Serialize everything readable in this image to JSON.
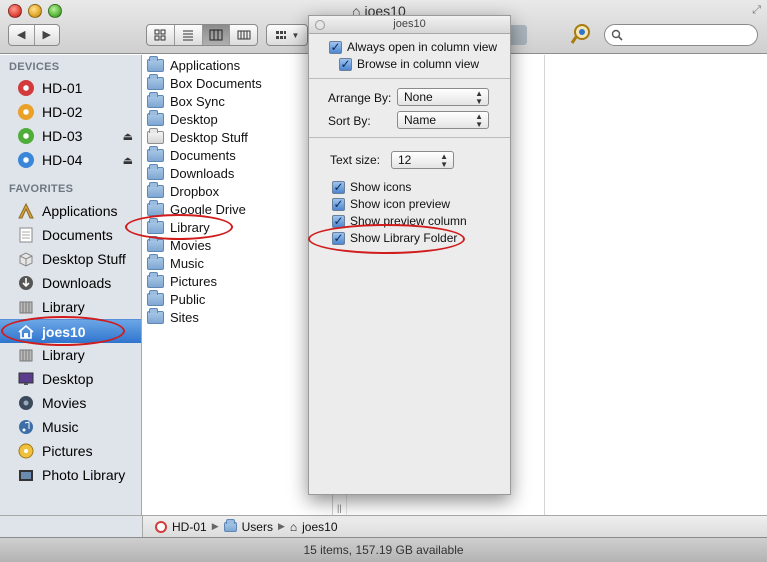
{
  "window": {
    "title": "joes10"
  },
  "toolbar": {
    "back_label": "◀",
    "forward_label": "▶",
    "search_placeholder": ""
  },
  "sidebar": {
    "devices_header": "DEVICES",
    "devices": [
      {
        "label": "HD-01",
        "color": "#d23b3b",
        "eject": false
      },
      {
        "label": "HD-02",
        "color": "#e9a12a",
        "eject": false
      },
      {
        "label": "HD-03",
        "color": "#4fae3a",
        "eject": true
      },
      {
        "label": "HD-04",
        "color": "#3a86d8",
        "eject": true
      }
    ],
    "favorites_header": "FAVORITES",
    "favorites": [
      {
        "label": "Applications",
        "icon": "applications-icon"
      },
      {
        "label": "Documents",
        "icon": "document-icon"
      },
      {
        "label": "Desktop Stuff",
        "icon": "box-icon"
      },
      {
        "label": "Downloads",
        "icon": "download-icon"
      },
      {
        "label": "Library",
        "icon": "library-icon"
      },
      {
        "label": "joes10",
        "icon": "home-icon",
        "selected": true
      },
      {
        "label": "Library",
        "icon": "library-icon"
      },
      {
        "label": "Desktop",
        "icon": "desktop-icon"
      },
      {
        "label": "Movies",
        "icon": "movies-icon"
      },
      {
        "label": "Music",
        "icon": "music-icon"
      },
      {
        "label": "Pictures",
        "icon": "pictures-icon"
      },
      {
        "label": "Photo Library",
        "icon": "photo-library-icon"
      }
    ]
  },
  "files": [
    "Applications",
    "Box Documents",
    "Box Sync",
    "Desktop",
    "Desktop Stuff",
    "Documents",
    "Downloads",
    "Dropbox",
    "Google Drive",
    "Library",
    "Movies",
    "Music",
    "Pictures",
    "Public",
    "Sites"
  ],
  "view_options": {
    "title": "joes10",
    "always_open_column": "Always open in column view",
    "browse_column": "Browse in column view",
    "arrange_by_label": "Arrange By:",
    "arrange_by_value": "None",
    "sort_by_label": "Sort By:",
    "sort_by_value": "Name",
    "text_size_label": "Text size:",
    "text_size_value": "12",
    "show_icons": "Show icons",
    "show_icon_preview": "Show icon preview",
    "show_preview_column": "Show preview column",
    "show_library_folder": "Show Library Folder"
  },
  "pathbar": [
    "HD-01",
    "Users",
    "joes10"
  ],
  "status": "15 items, 157.19 GB available",
  "colors": {
    "annotation": "#d01c1c",
    "selection": "#2f75cf"
  }
}
